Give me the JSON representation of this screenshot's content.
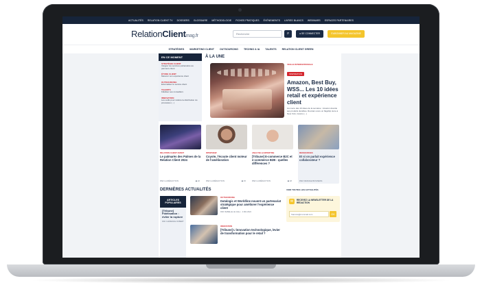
{
  "top_nav": [
    "ACTUALITÉS",
    "RELATION CLIENT TV",
    "DOSSIERS",
    "GLOSSAIRE",
    "MÉTHODOLOGIE",
    "FICHES PRATIQUES",
    "ÉVÉNEMENTS",
    "LIVRES BLANCS",
    "WEBINARS",
    "ESPACES PARTENAIRES"
  ],
  "header": {
    "logo_main": "Relation",
    "logo_bold": "Client",
    "logo_suffix": "mag.fr",
    "search_placeholder": "Recherche",
    "connect_label": "SE CONNECTER",
    "subscribe_label": "S'ABONNER AU MAGAZINE"
  },
  "category_nav": [
    "STRATÉGIES",
    "MARKETING CLIENT",
    "OUTSOURCING",
    "TECHNO & IA",
    "TALENTS",
    "RELATION CLIENT GREEN"
  ],
  "sidebar": {
    "title": "EN CE MOMENT",
    "items": [
      {
        "tag": "STRATÉGIE CLIENT",
        "text": "Intégrer les services partenaires au parcours client"
      },
      {
        "tag": "ÉTUDE CLIENT",
        "text": "Mesurer son expérience client"
      },
      {
        "tag": "OUTSOURCING",
        "text": "Externaliser le service client"
      },
      {
        "tag": "TALENTS",
        "text": "Fidéliser ses conseillers"
      },
      {
        "tag": "INNOVATION",
        "text": "Les outils pour réduire la distribution du processus (...)"
      }
    ]
  },
  "une": {
    "section_title": "À LA UNE",
    "category": "VEILLE INTERNATIONALE",
    "tag": "INSPIRATION",
    "title": "Amazon, Best Buy, WSS... Les 10 idées retail et expérience client",
    "description": "Au menu des 10 idées de la semaine : Amazon dévoile ses produits durables, Rovstar ouvre un flagship store à New York, Costco (...)"
  },
  "cards": [
    {
      "category": "RELATION CLIENT EVENT",
      "title": "Le palmarès des Palmes de la Relation Client 2024",
      "author": "PAR LA RÉDACTION",
      "reads": "22"
    },
    {
      "category": "INTERVIEW",
      "title": "Coyote, l'écoute client moteur de l'amélioration",
      "author": "PAR LA RÉDACTION",
      "reads": "15"
    },
    {
      "category": "ANALYSE & EXPERTISE",
      "title": "[Tribune] E-commerce B2C et e-commerce B2B : quelles différences ?",
      "author": "PAR LA RÉDACTION",
      "reads": "18"
    },
    {
      "category": "RESSOURCES",
      "title": "Et si on parlait expérience collaborateur ?",
      "author": "PAR ORANGE BUSINESS",
      "reads": ""
    }
  ],
  "latest": {
    "title": "DERNIÈRES ACTUALITÉS",
    "see_all": "VOIR TOUTES LES ACTUALITÉS",
    "popular_title": "ARTICLES POPULAIRES",
    "popular_item": {
      "title": "[Tribune] Fidélisation : éviter la rupture",
      "author": "PAR CLÉMENCE ROBERT"
    },
    "articles": [
      {
        "category": "OUTSOURCING",
        "title": "Datalogic et Worldline nouent un partenariat stratégique pour améliorer l'expérience client",
        "meta": "PAR ISABELLE LE GALL · 2 MAI 2024"
      },
      {
        "category": "INNOVATION",
        "title": "[Tribune] L'innovation technologique, levier de transformation pour le retail ?",
        "meta": ""
      }
    ]
  },
  "newsletter": {
    "title": "RECEVEZ LA NEWSLETTER DE LA RÉDACTION",
    "input_placeholder": "francois@monmail.com",
    "submit_label": "OK"
  }
}
